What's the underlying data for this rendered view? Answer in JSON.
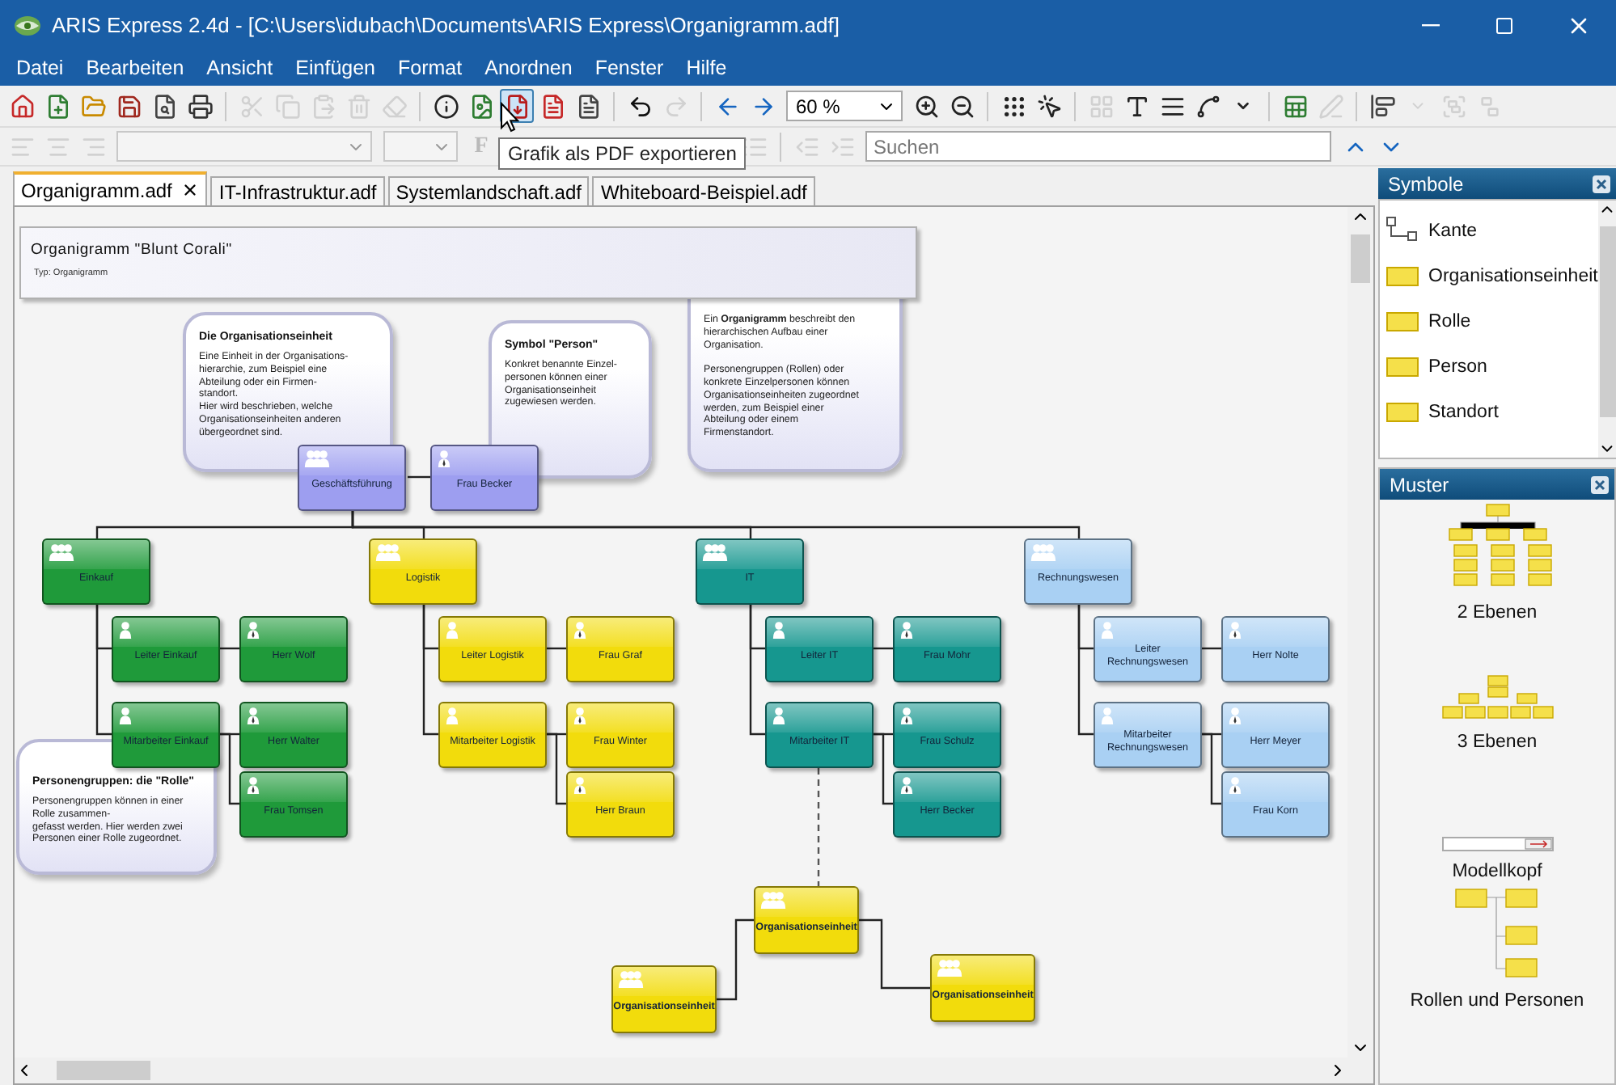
{
  "window": {
    "title": "ARIS Express 2.4d - [C:\\Users\\idubach\\Documents\\ARIS Express\\Organigramm.adf]"
  },
  "menu": [
    "Datei",
    "Bearbeiten",
    "Ansicht",
    "Einfügen",
    "Format",
    "Anordnen",
    "Fenster",
    "Hilfe"
  ],
  "toolbar": [
    {
      "kind": "home",
      "disabled": false,
      "hovered": false
    },
    {
      "kind": "new",
      "disabled": false,
      "hovered": false
    },
    {
      "kind": "open",
      "disabled": false,
      "hovered": false
    },
    {
      "kind": "save",
      "disabled": false,
      "hovered": false
    },
    {
      "kind": "preview",
      "disabled": false,
      "hovered": false
    },
    {
      "kind": "print",
      "disabled": false,
      "hovered": false
    },
    {
      "kind": "separator"
    },
    {
      "kind": "cut",
      "disabled": true,
      "hovered": false
    },
    {
      "kind": "copy",
      "disabled": true,
      "hovered": false
    },
    {
      "kind": "paste",
      "disabled": true,
      "hovered": false
    },
    {
      "kind": "delete",
      "disabled": true,
      "hovered": false
    },
    {
      "kind": "eraser",
      "disabled": true,
      "hovered": false
    },
    {
      "kind": "separator"
    },
    {
      "kind": "info",
      "disabled": false,
      "hovered": false
    },
    {
      "kind": "export-image",
      "disabled": false,
      "hovered": false
    },
    {
      "kind": "export-pdf",
      "disabled": false,
      "hovered": true
    },
    {
      "kind": "export-document",
      "disabled": false,
      "hovered": false
    },
    {
      "kind": "export-text",
      "disabled": false,
      "hovered": false
    },
    {
      "kind": "separator"
    },
    {
      "kind": "undo",
      "disabled": false,
      "hovered": false
    },
    {
      "kind": "redo",
      "disabled": true,
      "hovered": false
    },
    {
      "kind": "separator"
    },
    {
      "kind": "back",
      "disabled": false,
      "hovered": false
    },
    {
      "kind": "forward",
      "disabled": false,
      "hovered": false
    },
    {
      "kind": "zoom",
      "value": "60 %"
    },
    {
      "kind": "zoom-in",
      "disabled": false,
      "hovered": false
    },
    {
      "kind": "zoom-out",
      "disabled": false,
      "hovered": false
    },
    {
      "kind": "separator"
    },
    {
      "kind": "grid",
      "disabled": false,
      "hovered": false
    },
    {
      "kind": "snap",
      "disabled": false,
      "hovered": false
    },
    {
      "kind": "separator"
    },
    {
      "kind": "arrange",
      "disabled": true,
      "hovered": false
    },
    {
      "kind": "text-style",
      "disabled": false,
      "hovered": false
    },
    {
      "kind": "text-format",
      "disabled": false,
      "hovered": false
    },
    {
      "kind": "line-style",
      "disabled": false,
      "hovered": false
    },
    {
      "kind": "caret",
      "disabled": false,
      "hovered": false
    },
    {
      "kind": "separator"
    },
    {
      "kind": "insert",
      "disabled": false,
      "hovered": false
    },
    {
      "kind": "edit",
      "disabled": true,
      "hovered": false
    },
    {
      "kind": "separator"
    },
    {
      "kind": "align-shapes",
      "disabled": false,
      "hovered": false
    },
    {
      "kind": "caret",
      "disabled": true,
      "hovered": false
    },
    {
      "kind": "group",
      "disabled": true,
      "hovered": false
    },
    {
      "kind": "ungroup",
      "disabled": true,
      "hovered": false
    }
  ],
  "format_bar": [
    {
      "kind": "align-left",
      "disabled": true
    },
    {
      "kind": "align-center",
      "disabled": true
    },
    {
      "kind": "align-right",
      "disabled": true
    },
    {
      "kind": "font"
    },
    {
      "kind": "size"
    },
    {
      "kind": "bold",
      "label": "F",
      "disabled": true
    },
    {
      "kind": "list",
      "disabled": true
    },
    {
      "kind": "separator"
    },
    {
      "kind": "outdent",
      "disabled": true
    },
    {
      "kind": "indent",
      "disabled": true
    },
    {
      "kind": "search",
      "placeholder": "Suchen"
    },
    {
      "kind": "up",
      "disabled": false
    },
    {
      "kind": "down",
      "disabled": false
    }
  ],
  "tooltip": "Grafik als PDF exportieren",
  "tabs": [
    {
      "label": "Organigramm.adf",
      "selected": true
    },
    {
      "label": "IT-Infrastruktur.adf",
      "selected": false
    },
    {
      "label": "Systemlandschaft.adf",
      "selected": false
    },
    {
      "label": "Whiteboard-Beispiel.adf",
      "selected": false
    }
  ],
  "diagram": {
    "header": {
      "title": "Organigramm \"Blunt Corali\"",
      "subtitle": "Typ: Organigramm"
    },
    "notes": [
      {
        "title": "Die Organisationseinheit",
        "text": "Eine Einheit in der Organisations-\nhierarchie, zum Beispiel eine\nAbteilung oder ein Firmen-\nstandort.\nHier wird beschrieben, welche\nOrganisationseinheiten anderen\nübergeordnet sind."
      },
      {
        "title": "Symbol \"Person\"",
        "text": "Konkret benannte Einzel-\npersonen können einer\nOrganisationseinheit\nzugewiesen werden."
      },
      {
        "text": "Ein **Organigramm** beschreibt den\nhierarchischen Aufbau einer\nOrganisation.\n\nPersonengruppen (Rollen) oder\nkonkrete Einzelpersonen können\nOrganisationseinheiten zugeordnet\nwerden, zum Beispiel einer\nAbteilung oder einem\nFirmenstandort."
      },
      {
        "title": "Personengruppen: die \"Rolle\"",
        "text": "Personengruppen können in einer\nRolle zusammen-\ngefasst werden. Hier werden zwei\nPersonen einer Rolle zugeordnet."
      }
    ],
    "top": {
      "unit": "Geschäftsführung",
      "person": "Frau Becker"
    },
    "departments": [
      {
        "unit": "Einkauf",
        "color": "#1f9a3a",
        "roles": [
          {
            "role": "Leiter Einkauf",
            "persons": [
              "Herr Wolf"
            ]
          },
          {
            "role": "Mitarbeiter Einkauf",
            "persons": [
              "Herr Walter",
              "Frau Tomsen"
            ]
          }
        ]
      },
      {
        "unit": "Logistik",
        "color": "#f2dc0c",
        "roles": [
          {
            "role": "Leiter Logistik",
            "persons": [
              "Frau Graf"
            ]
          },
          {
            "role": "Mitarbeiter Logistik",
            "persons": [
              "Frau Winter",
              "Herr Braun"
            ]
          }
        ]
      },
      {
        "unit": "IT",
        "color": "#16978f",
        "roles": [
          {
            "role": "Leiter IT",
            "persons": [
              "Frau Mohr"
            ]
          },
          {
            "role": "Mitarbeiter IT",
            "persons": [
              "Frau Schulz",
              "Herr Becker"
            ]
          }
        ]
      },
      {
        "unit": "Rechnungswesen",
        "color": "#a9d0f3",
        "roles": [
          {
            "role": "Leiter\nRechnungswesen",
            "persons": [
              "Herr Nolte"
            ]
          },
          {
            "role": "Mitarbeiter\nRechnungswesen",
            "persons": [
              "Herr Meyer",
              "Frau Korn"
            ]
          }
        ]
      }
    ],
    "sub_units": [
      "Organisationseinheit",
      "Organisationseinheit",
      "Organisationseinheit"
    ]
  },
  "symbols_panel": {
    "title": "Symbole",
    "items": [
      {
        "label": "Kante",
        "kind": "edge"
      },
      {
        "label": "Organisationseinheit",
        "kind": "shape"
      },
      {
        "label": "Rolle",
        "kind": "shape"
      },
      {
        "label": "Person",
        "kind": "shape"
      },
      {
        "label": "Standort",
        "kind": "shape"
      }
    ]
  },
  "patterns_panel": {
    "title": "Muster",
    "items": [
      {
        "label": "2 Ebenen",
        "kind": "two-level"
      },
      {
        "label": "3 Ebenen",
        "kind": "three-level"
      },
      {
        "label": "Modellkopf",
        "kind": "header"
      },
      {
        "label": "Rollen und Personen",
        "kind": "roles"
      }
    ]
  }
}
